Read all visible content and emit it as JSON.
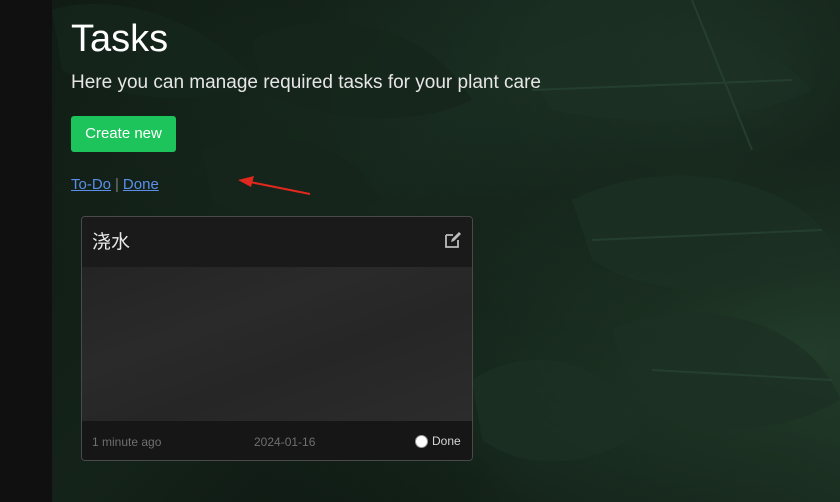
{
  "header": {
    "title": "Tasks",
    "subtitle": "Here you can manage required tasks for your plant care"
  },
  "actions": {
    "create_label": "Create new"
  },
  "filters": {
    "todo_label": "To-Do",
    "separator": "|",
    "done_label": "Done",
    "active": "Done"
  },
  "tasks": [
    {
      "title": "浇水",
      "relative_time": "1 minute ago",
      "date": "2024-01-16",
      "done_label": "Done",
      "done_checked": false,
      "edit_icon": "edit-icon"
    }
  ],
  "colors": {
    "accent_green": "#1dc45c",
    "link_blue": "#5b8fe8",
    "annotation_red": "#e0281e"
  }
}
